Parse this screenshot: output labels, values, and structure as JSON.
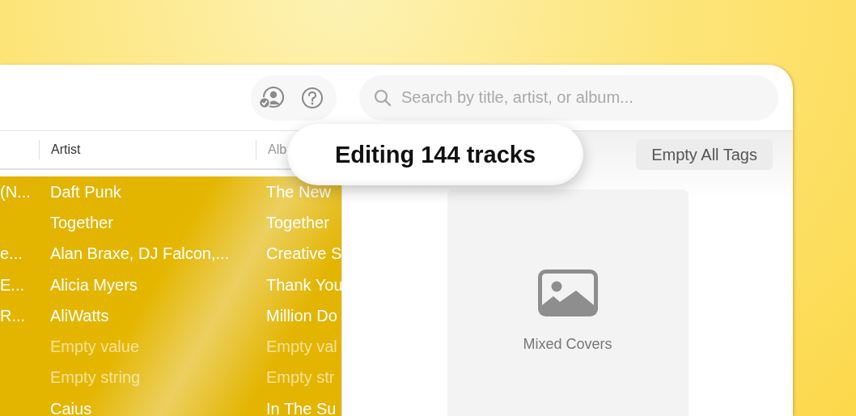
{
  "toolbar": {
    "search": {
      "placeholder": "Search by title, artist, or album..."
    }
  },
  "table": {
    "columns": [
      "Artist",
      "Alb"
    ],
    "rows": [
      {
        "column_1": "(N...",
        "artist": "Daft Punk",
        "album": "The New",
        "selected": true,
        "empty": false
      },
      {
        "artist": "Together",
        "album": "Together",
        "selected": true,
        "empty": false
      },
      {
        "column_1": "e...",
        "artist": "Alan Braxe, DJ Falcon,...",
        "album": "Creative S",
        "selected": true,
        "empty": false
      },
      {
        "column_1": "E...",
        "artist": "Alicia Myers",
        "album": "Thank You",
        "selected": true,
        "empty": false
      },
      {
        "column_1": "R...",
        "artist": "AliWatts",
        "album": "Million Do",
        "selected": true,
        "empty": false
      },
      {
        "artist": "Empty value",
        "album": "Empty val",
        "selected": true,
        "empty": true
      },
      {
        "artist": "Empty string",
        "album": "Empty str",
        "selected": true,
        "empty": true
      },
      {
        "artist": "Caius",
        "album": "In The Su",
        "selected": true,
        "empty": false
      }
    ]
  },
  "popover": {
    "text": "Editing 144 tracks"
  },
  "editor": {
    "button": "Empty All Tags",
    "cover": {
      "label": "Mixed Covers"
    }
  }
}
